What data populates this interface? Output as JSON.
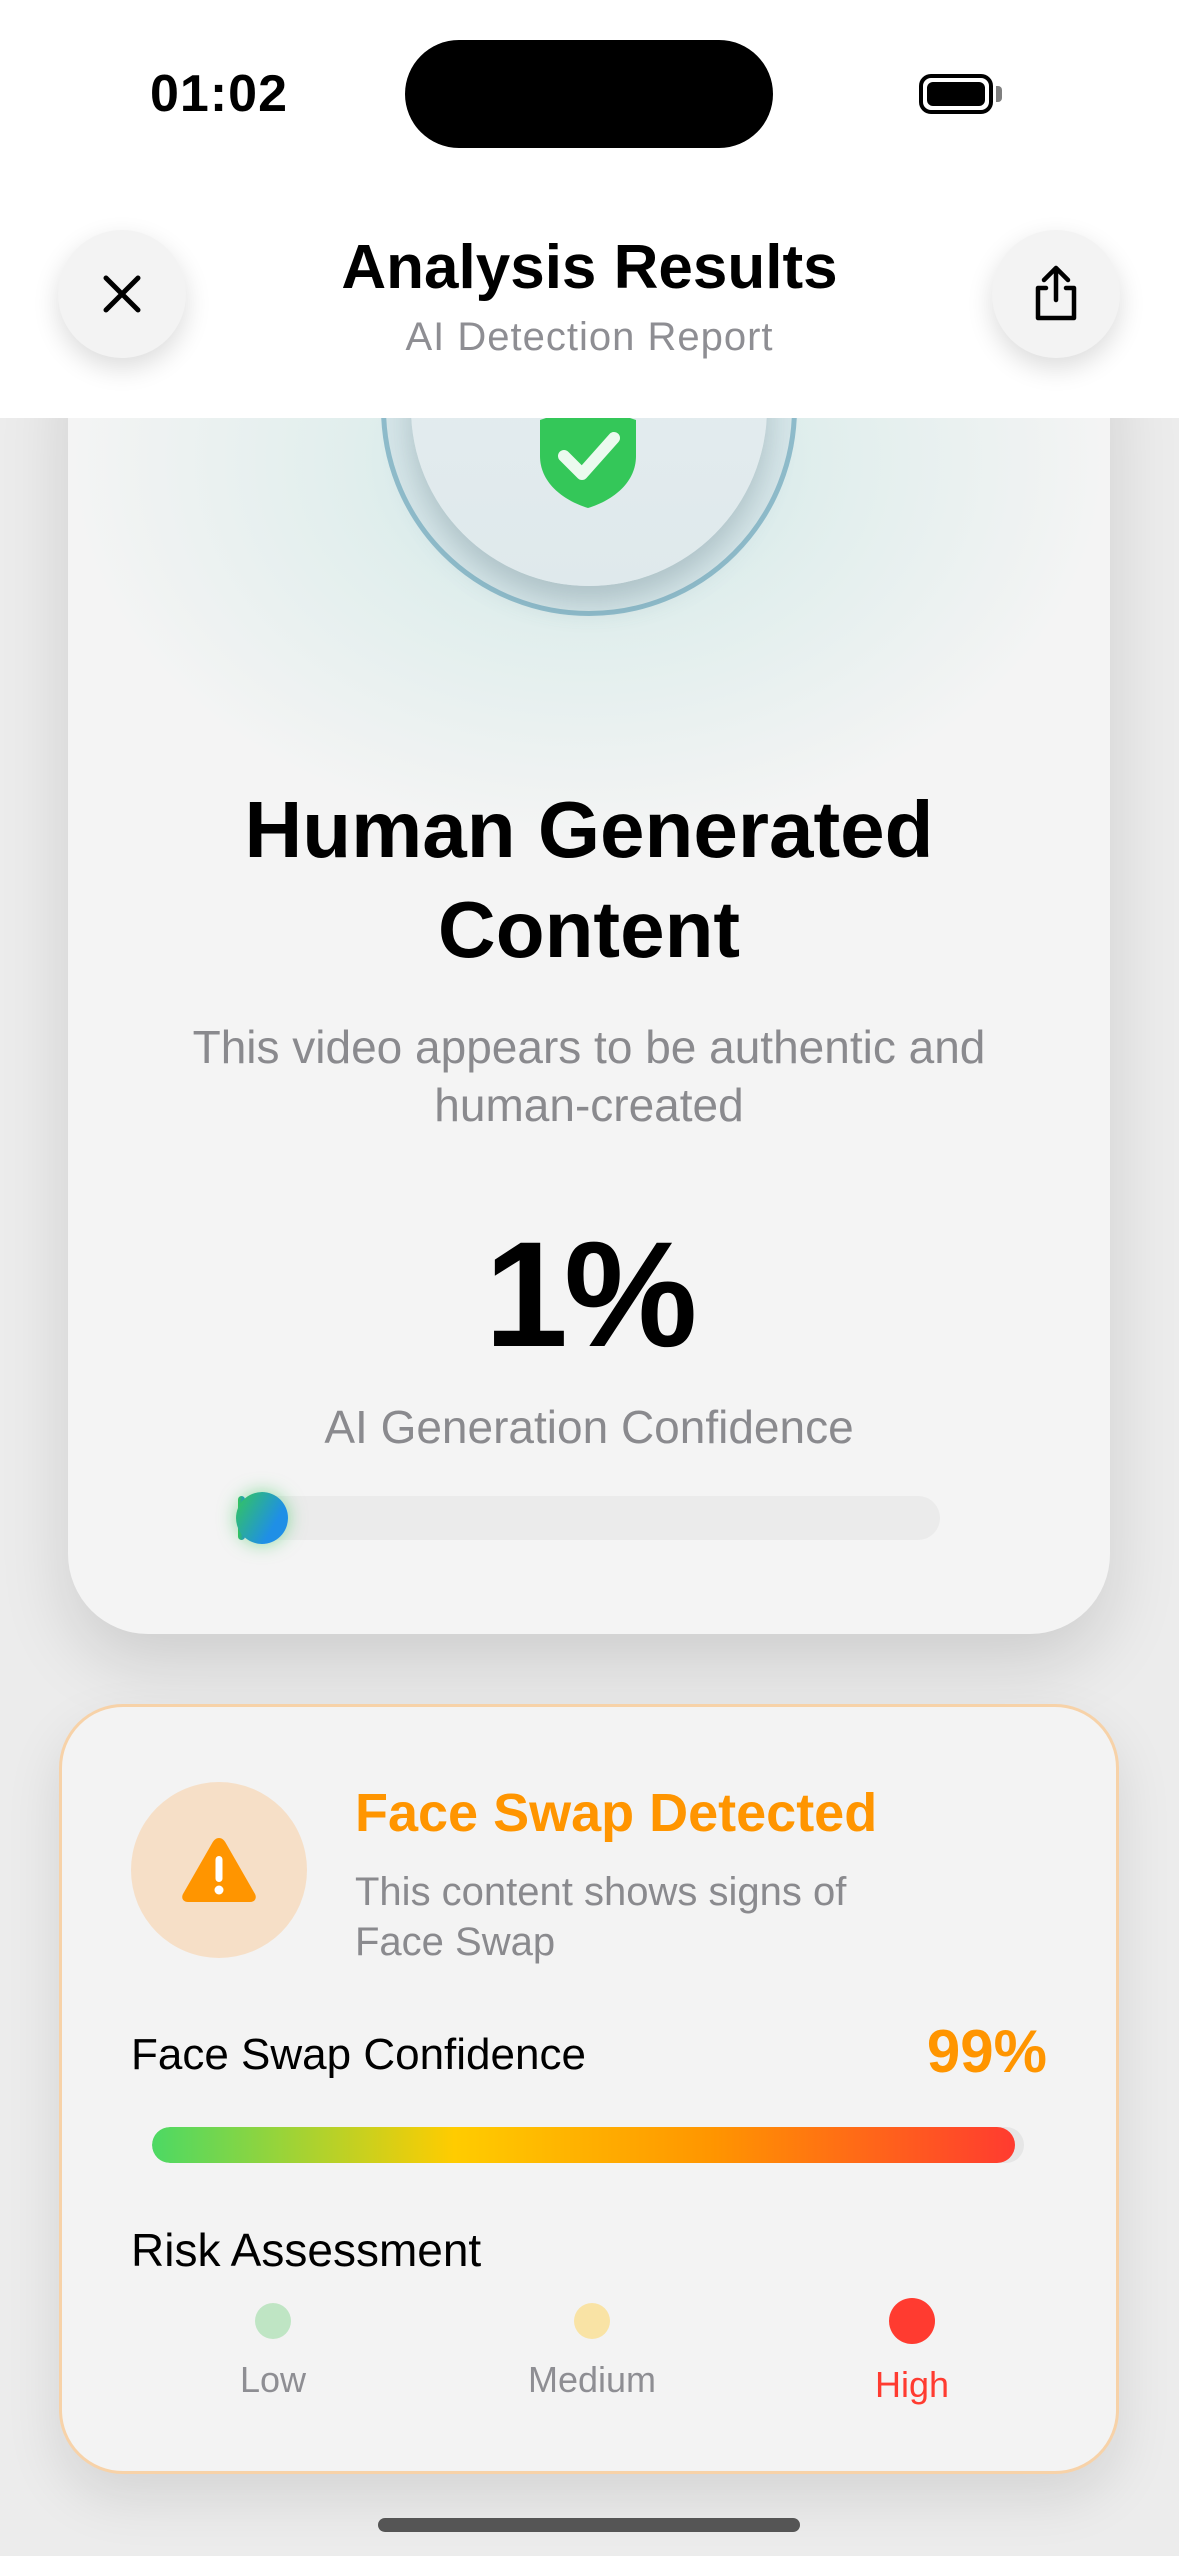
{
  "status_bar": {
    "time": "01:02"
  },
  "header": {
    "title": "Analysis Results",
    "subtitle": "AI Detection Report",
    "close_icon": "close-icon",
    "share_icon": "share-icon"
  },
  "result": {
    "badge_icon": "shield-check-icon",
    "title_lines": [
      "Human Generated",
      "Content"
    ],
    "description_lines": [
      "This video appears to be authentic and",
      "human-created"
    ],
    "percent": "1%",
    "confidence_label": "AI Generation Confidence",
    "confidence_fraction": 0.01,
    "colors": {
      "green": "#34c759",
      "blue": "#1e88e5"
    }
  },
  "face_swap": {
    "icon": "warning-icon",
    "title": "Face Swap Detected",
    "description_lines": [
      "This content shows signs of",
      "Face Swap"
    ],
    "confidence_label": "Face Swap Confidence",
    "confidence_value": "99%",
    "confidence_fraction": 0.99,
    "risk_title": "Risk Assessment",
    "risk_levels": [
      {
        "label": "Low",
        "active": false,
        "color": "#bfe5c4",
        "text_color": "#8e8e93"
      },
      {
        "label": "Medium",
        "active": false,
        "color": "#f9e3a5",
        "text_color": "#8e8e93"
      },
      {
        "label": "High",
        "active": true,
        "color": "#ff3b30",
        "text_color": "#ff3b30"
      }
    ],
    "accent_color": "#ff9500"
  }
}
